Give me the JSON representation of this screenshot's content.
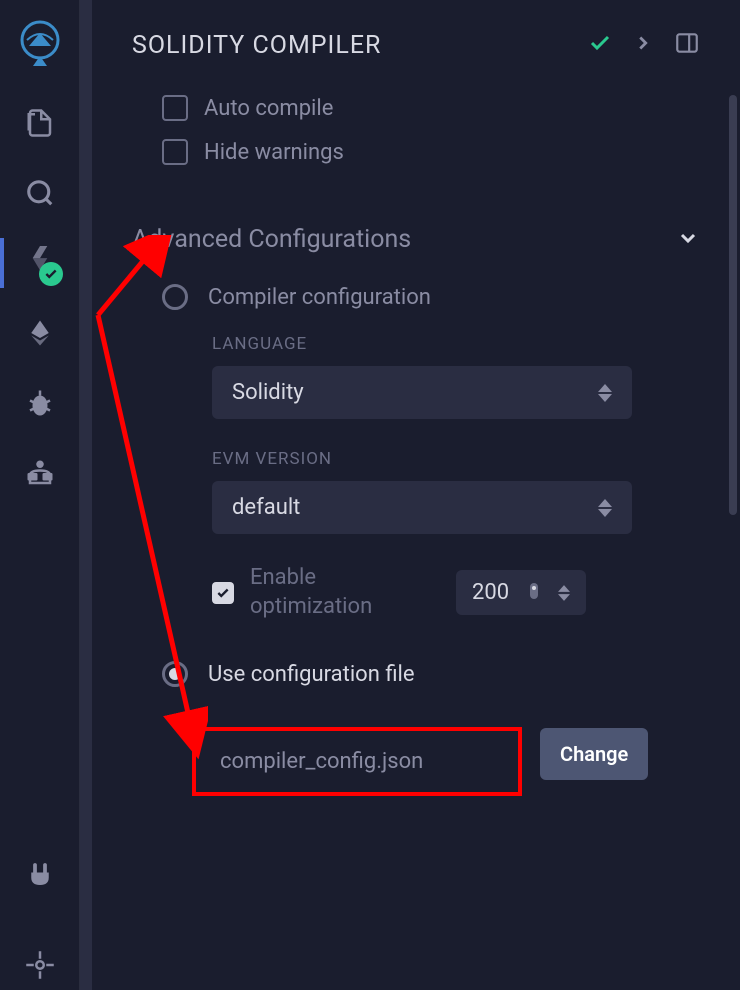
{
  "header": {
    "title": "SOLIDITY COMPILER"
  },
  "checkboxes": {
    "autoCompile": "Auto compile",
    "hideWarnings": "Hide warnings"
  },
  "advanced": {
    "title": "Advanced Configurations",
    "compilerConfig": "Compiler configuration",
    "languageLabel": "LANGUAGE",
    "languageValue": "Solidity",
    "evmLabel": "EVM VERSION",
    "evmValue": "default",
    "enableOptimization": "Enable optimization",
    "optimizationValue": "200",
    "useConfigFile": "Use configuration file",
    "configFileName": "compiler_config.json",
    "changeButton": "Change"
  }
}
